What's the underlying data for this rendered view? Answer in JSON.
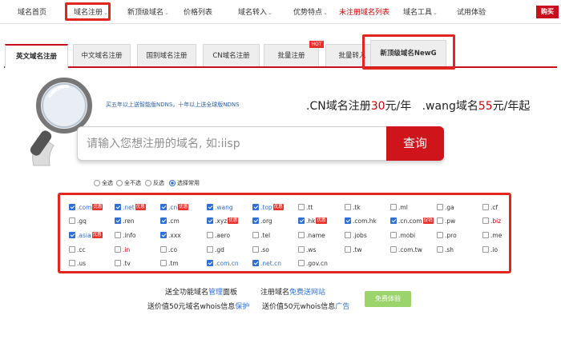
{
  "nav": {
    "items": [
      {
        "label": "域名首页",
        "caret": false,
        "red": false
      },
      {
        "label": "域名注册",
        "caret": true,
        "red": false
      },
      {
        "label": "新顶级域名",
        "caret": true,
        "red": false
      },
      {
        "label": "价格列表",
        "caret": false,
        "red": false
      },
      {
        "label": "域名转入",
        "caret": true,
        "red": false
      },
      {
        "label": "优势特点",
        "caret": true,
        "red": false
      },
      {
        "label": "未注册域名列表",
        "caret": false,
        "red": true
      },
      {
        "label": "域名工具",
        "caret": true,
        "red": false
      },
      {
        "label": "试用体验",
        "caret": false,
        "red": false
      }
    ],
    "buy_label": "购买",
    "caret_glyph": "⌄"
  },
  "tabs": {
    "items": [
      {
        "label": "英文域名注册"
      },
      {
        "label": "中文域名注册"
      },
      {
        "label": "国别域名注册"
      },
      {
        "label": "CN域名注册"
      },
      {
        "label": "批量注册"
      },
      {
        "label": "批量转入"
      },
      {
        "label": "新顶级域名NewG"
      }
    ],
    "hot_badge": "HOT"
  },
  "promo": {
    "small": "买五年以上送智能版NDNS，十年以上送全球版NDNS",
    "cn_prefix": ".CN域名注册",
    "cn_price": "30",
    "cn_suffix": "元/年",
    "wang_prefix": ".wang域名",
    "wang_price": "55",
    "wang_suffix": "元/年起"
  },
  "search": {
    "placeholder": "请输入您想注册的域名, 如:iisp",
    "button": "查询"
  },
  "select_options": [
    {
      "label": "全选",
      "checked": false
    },
    {
      "label": "全不选",
      "checked": false
    },
    {
      "label": "反选",
      "checked": false
    },
    {
      "label": "选择常用",
      "checked": true
    }
  ],
  "domains": [
    [
      {
        "label": ".com",
        "checked": true,
        "color": "blue",
        "badge": "优惠"
      },
      {
        "label": ".net",
        "checked": true,
        "color": "blue",
        "badge": "优惠"
      },
      {
        "label": ".cn",
        "checked": true,
        "color": "blue",
        "badge": "优惠"
      },
      {
        "label": ".wang",
        "checked": true,
        "color": "blue",
        "badge": ""
      },
      {
        "label": ".top",
        "checked": true,
        "color": "blue",
        "badge": "优惠"
      },
      {
        "label": ".tt",
        "checked": false,
        "color": "",
        "badge": ""
      },
      {
        "label": ".tk",
        "checked": false,
        "color": "",
        "badge": ""
      },
      {
        "label": ".ml",
        "checked": false,
        "color": "",
        "badge": ""
      },
      {
        "label": ".ga",
        "checked": false,
        "color": "",
        "badge": ""
      },
      {
        "label": ".cf",
        "checked": false,
        "color": "",
        "badge": ""
      }
    ],
    [
      {
        "label": ".gq",
        "checked": false,
        "color": "",
        "badge": ""
      },
      {
        "label": ".ren",
        "checked": true,
        "color": "",
        "badge": ""
      },
      {
        "label": ".cm",
        "checked": true,
        "color": "",
        "badge": ""
      },
      {
        "label": ".xyz",
        "checked": true,
        "color": "",
        "badge": "优惠"
      },
      {
        "label": ".org",
        "checked": true,
        "color": "",
        "badge": ""
      },
      {
        "label": ".hk",
        "checked": true,
        "color": "",
        "badge": "优惠"
      },
      {
        "label": ".com.hk",
        "checked": true,
        "color": "",
        "badge": ""
      },
      {
        "label": ".cn.com",
        "checked": true,
        "color": "",
        "badge": "促销"
      },
      {
        "label": ".pw",
        "checked": false,
        "color": "",
        "badge": ""
      },
      {
        "label": ".biz",
        "checked": false,
        "color": "red",
        "badge": ""
      }
    ],
    [
      {
        "label": ".asia",
        "checked": true,
        "color": "blue",
        "badge": "优惠"
      },
      {
        "label": ".info",
        "checked": false,
        "color": "",
        "badge": ""
      },
      {
        "label": ".xxx",
        "checked": true,
        "color": "",
        "badge": ""
      },
      {
        "label": ".aero",
        "checked": false,
        "color": "",
        "badge": ""
      },
      {
        "label": ".tel",
        "checked": false,
        "color": "",
        "badge": ""
      },
      {
        "label": ".name",
        "checked": false,
        "color": "",
        "badge": ""
      },
      {
        "label": ".jobs",
        "checked": false,
        "color": "",
        "badge": ""
      },
      {
        "label": ".mobi",
        "checked": false,
        "color": "",
        "badge": ""
      },
      {
        "label": ".pro",
        "checked": false,
        "color": "",
        "badge": ""
      },
      {
        "label": ".me",
        "checked": false,
        "color": "",
        "badge": ""
      }
    ],
    [
      {
        "label": ".cc",
        "checked": false,
        "color": "",
        "badge": ""
      },
      {
        "label": ".in",
        "checked": false,
        "color": "red",
        "badge": ""
      },
      {
        "label": ".co",
        "checked": false,
        "color": "",
        "badge": ""
      },
      {
        "label": ".gd",
        "checked": false,
        "color": "",
        "badge": ""
      },
      {
        "label": ".so",
        "checked": false,
        "color": "",
        "badge": ""
      },
      {
        "label": ".ws",
        "checked": false,
        "color": "",
        "badge": ""
      },
      {
        "label": ".tw",
        "checked": false,
        "color": "",
        "badge": ""
      },
      {
        "label": ".com.tw",
        "checked": false,
        "color": "",
        "badge": ""
      },
      {
        "label": ".sh",
        "checked": false,
        "color": "",
        "badge": ""
      },
      {
        "label": ".io",
        "checked": false,
        "color": "",
        "badge": ""
      }
    ],
    [
      {
        "label": ".us",
        "checked": false,
        "color": "",
        "badge": ""
      },
      {
        "label": ".tv",
        "checked": false,
        "color": "",
        "badge": ""
      },
      {
        "label": ".tm",
        "checked": false,
        "color": "",
        "badge": ""
      },
      {
        "label": ".com.cn",
        "checked": true,
        "color": "blue",
        "badge": ""
      },
      {
        "label": ".net.cn",
        "checked": true,
        "color": "blue",
        "badge": ""
      },
      {
        "label": ".gov.cn",
        "checked": false,
        "color": "",
        "badge": ""
      }
    ]
  ],
  "footer": {
    "line1_a_pre": "送全功能域名",
    "line1_a_link": "管理",
    "line1_a_post": "面板",
    "line1_b_pre": "注册域名",
    "line1_b_link": "免费送网站",
    "line2_a_pre": "送价值50元域名whois信息",
    "line2_a_link": "保护",
    "line2_b_pre": "送价值50元whois信息",
    "line2_b_link": "广告",
    "trial_button": "免费体验"
  },
  "colors": {
    "accent": "#c8101d",
    "link": "#2e6fd8",
    "button": "#d0141c",
    "trial": "#9bd46a"
  }
}
